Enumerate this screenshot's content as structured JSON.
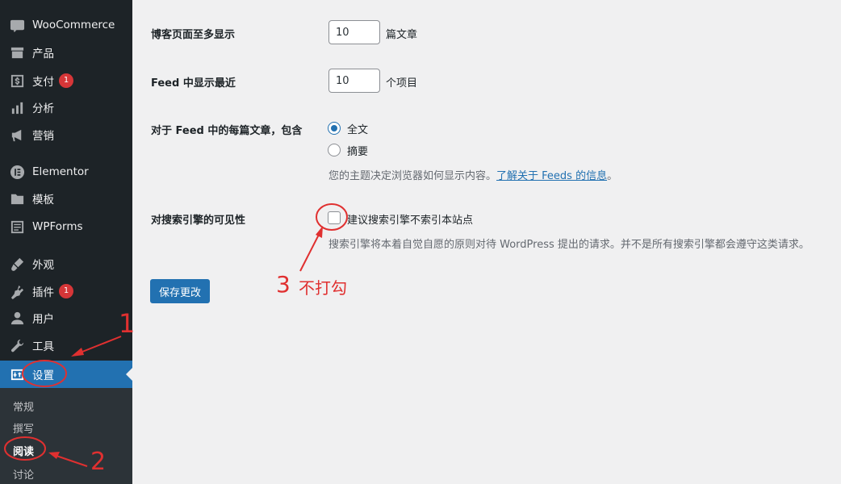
{
  "sidebar": {
    "items": [
      {
        "label": "WooCommerce",
        "icon": "woocommerce-icon"
      },
      {
        "label": "产品",
        "icon": "products-icon"
      },
      {
        "label": "支付",
        "icon": "payment-icon",
        "badge": "1"
      },
      {
        "label": "分析",
        "icon": "analytics-icon"
      },
      {
        "label": "营销",
        "icon": "marketing-icon"
      },
      {
        "label": "Elementor",
        "icon": "elementor-icon"
      },
      {
        "label": "模板",
        "icon": "folder-icon"
      },
      {
        "label": "WPForms",
        "icon": "wpforms-icon"
      },
      {
        "label": "外观",
        "icon": "appearance-icon"
      },
      {
        "label": "插件",
        "icon": "plugins-icon",
        "badge": "1"
      },
      {
        "label": "用户",
        "icon": "users-icon"
      },
      {
        "label": "工具",
        "icon": "tools-icon"
      },
      {
        "label": "设置",
        "icon": "settings-icon",
        "current": true
      }
    ],
    "submenu": [
      {
        "label": "常规"
      },
      {
        "label": "撰写"
      },
      {
        "label": "阅读",
        "active": true
      },
      {
        "label": "讨论"
      }
    ]
  },
  "settings": {
    "posts_per_page": {
      "label": "博客页面至多显示",
      "value": "10",
      "suffix": "篇文章"
    },
    "posts_per_rss": {
      "label": "Feed 中显示最近",
      "value": "10",
      "suffix": "个项目"
    },
    "feed_content": {
      "label": "对于 Feed 中的每篇文章，包含",
      "options": [
        {
          "label": "全文",
          "checked": true
        },
        {
          "label": "摘要",
          "checked": false
        }
      ],
      "description": "您的主题决定浏览器如何显示内容。",
      "link_text": "了解关于 Feeds 的信息",
      "link_suffix": "。"
    },
    "search_visibility": {
      "label": "对搜索引擎的可见性",
      "checkbox_label": "建议搜索引擎不索引本站点",
      "checked": false,
      "description": "搜索引擎将本着自觉自愿的原则对待 WordPress 提出的请求。并不是所有搜索引擎都会遵守这类请求。"
    },
    "save_label": "保存更改"
  },
  "annotations": {
    "step1": "1",
    "step2": "2",
    "step3": "3",
    "step3_note": "不打勾",
    "color": "#e03030"
  },
  "colors": {
    "sidebar_bg": "#1d2327",
    "submenu_bg": "#2c3338",
    "accent": "#2271b1",
    "badge": "#d63638",
    "page_bg": "#f0f0f1"
  }
}
